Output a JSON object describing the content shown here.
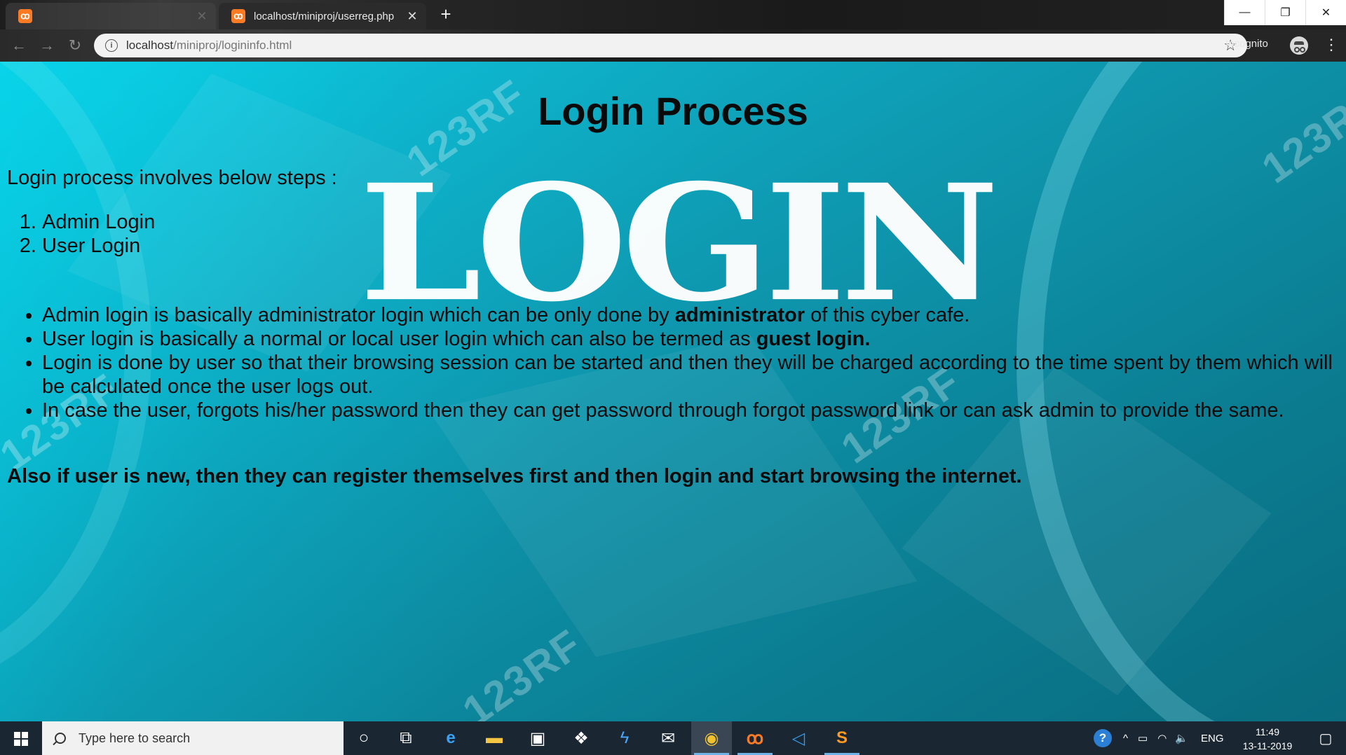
{
  "browser": {
    "tabs": [
      {
        "title": "",
        "favicon": "xampp-icon",
        "active": false
      },
      {
        "title": "localhost/miniproj/userreg.php",
        "favicon": "xampp-icon",
        "active": true
      }
    ],
    "new_tab_symbol": "+",
    "address": {
      "host": "localhost",
      "path": "/miniproj/logininfo.html"
    },
    "incognito_label": "Incognito",
    "window_controls": {
      "minimize": "—",
      "restore": "❐",
      "close": "✕"
    }
  },
  "page": {
    "title": "Login Process",
    "background_word": "LOGIN",
    "watermark": "123RF",
    "intro": "Login process involves below steps :",
    "steps": [
      "Admin Login",
      "User Login"
    ],
    "notes": [
      {
        "before": "Admin login is basically administrator login which can be only done by ",
        "bold": "administrator",
        "after": " of this cyber cafe."
      },
      {
        "before": "User login is basically a normal or local user login which can also be termed as ",
        "bold": "guest login.",
        "after": ""
      },
      {
        "before": "Login is done by user so that their browsing session can be started and then they will be charged according to the time spent by them which will be calculated once the user logs out.",
        "bold": "",
        "after": ""
      },
      {
        "before": "In case the user, forgots his/her password then they can get password through forgot password link or can ask admin to provide the same.",
        "bold": "",
        "after": ""
      }
    ],
    "footer_note": "Also if user is new, then they can register themselves first and then login and start browsing the internet."
  },
  "taskbar": {
    "search_placeholder": "Type here to search",
    "language": "ENG",
    "time": "11:49",
    "date": "13-11-2019"
  },
  "colors": {
    "page_background": "#0e8fa2",
    "text": "#0a0a0a",
    "taskbar": "#1b2633",
    "xampp": "#fb7a24"
  }
}
